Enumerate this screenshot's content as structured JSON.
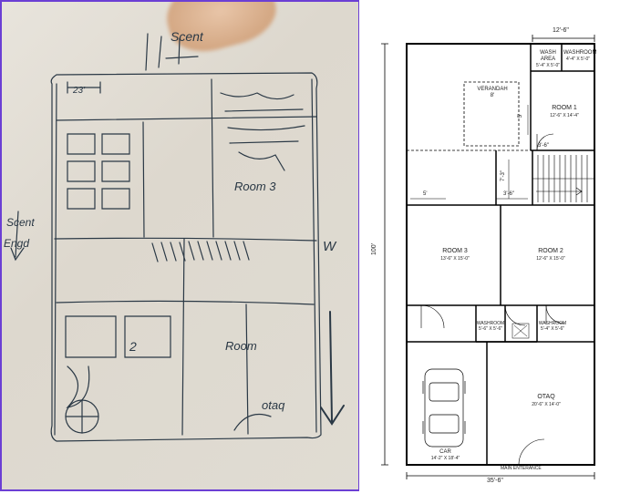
{
  "sketch": {
    "label_scent": "Scent",
    "dim_23": "23'",
    "room3": "Room 3",
    "side_scent": "Scent",
    "side_engd": "Engd",
    "label_w": "W",
    "label_room": "Room",
    "label_2": "2",
    "label_otaq": "otaq"
  },
  "plan": {
    "height_dim": "100'",
    "width_dim": "35'-6\"",
    "top_dim": "12'-6\"",
    "wash_area": "WASH AREA",
    "wash_area_dim": "5'-4\" X 5'-0\"",
    "washroom1": "WASHROOM",
    "washroom1_dim": "4'-4\" X 5'-0\"",
    "verandah": "VERANDAH",
    "verandah_dim": "8'",
    "room1": "ROOM 1",
    "room1_dim": "12'-6\" X 14'-4\"",
    "dim_5a": "5'",
    "dim_36a": "3'-6\"",
    "dim_5b": "5'",
    "dim_36b": "3'-6\"",
    "dim_73": "7'-3\"",
    "room3": "ROOM 3",
    "room3_dim": "13'-6\" X 15'-0\"",
    "room2": "ROOM 2",
    "room2_dim": "12'-6\" X 15'-0\"",
    "washroom2": "WASHROOM",
    "washroom2_dim": "5'-6\" X 5'-6\"",
    "washroom3": "WASHROOM",
    "washroom3_dim": "5'-4\" X 5'-6\"",
    "car": "CAR",
    "car_dim": "14'-2\" X 18'-4\"",
    "otaq": "OTAQ",
    "otaq_dim": "20'-6\" X 14'-0\"",
    "main_ent": "MAIN ENTERANCE"
  }
}
